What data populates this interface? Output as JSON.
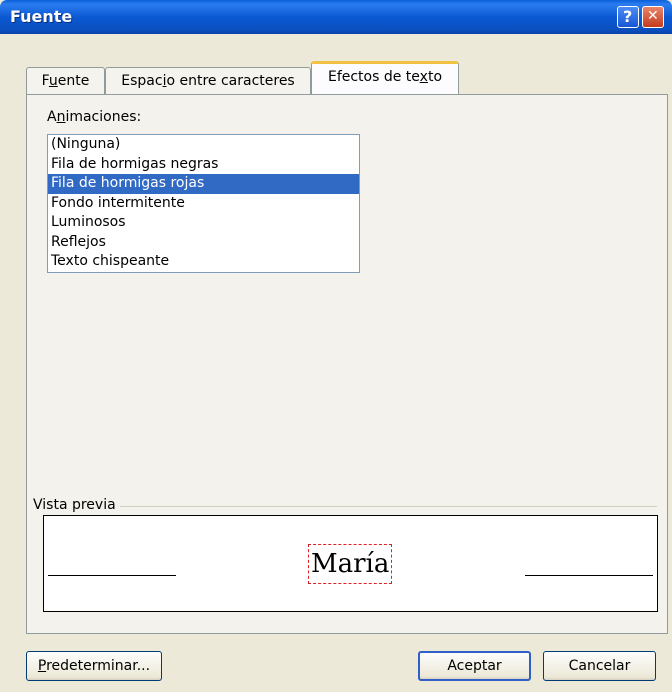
{
  "window": {
    "title": "Fuente"
  },
  "title_buttons": {
    "help": "?",
    "close": "✕"
  },
  "tabs": [
    {
      "before": "F",
      "underlined": "u",
      "after": "ente"
    },
    {
      "before": "Espac",
      "underlined": "i",
      "after": "o entre caracteres"
    },
    {
      "before": "Efectos de te",
      "underlined": "x",
      "after": "to"
    }
  ],
  "animations": {
    "label_before": "A",
    "label_underlined": "n",
    "label_after": "imaciones:",
    "items": [
      "(Ninguna)",
      "Fila de hormigas negras",
      "Fila de hormigas rojas",
      "Fondo intermitente",
      "Luminosos",
      "Reflejos",
      "Texto chispeante"
    ],
    "selected": "Fila de hormigas rojas"
  },
  "preview": {
    "label": "Vista previa",
    "text": "María"
  },
  "buttons": {
    "default_underlined": "P",
    "default_after": "redeterminar...",
    "ok": "Aceptar",
    "cancel": "Cancelar"
  }
}
